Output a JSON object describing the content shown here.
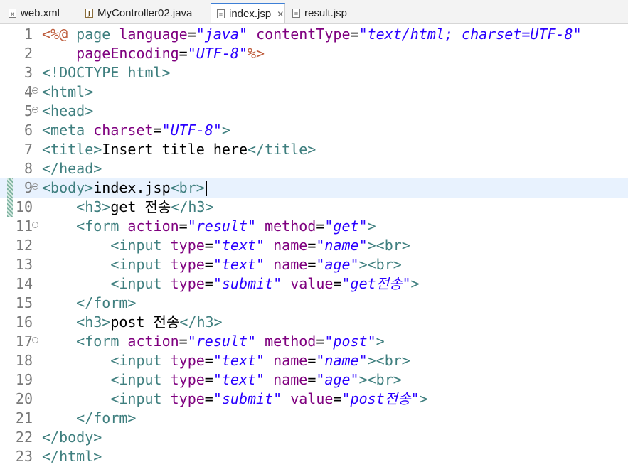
{
  "tabs": [
    {
      "label": "web.xml",
      "icon": "xml-file-icon"
    },
    {
      "label": "MyController02.java",
      "icon": "java-file-icon"
    },
    {
      "label": "index.jsp",
      "icon": "jsp-file-icon",
      "active": true,
      "close_icon": "close-icon"
    },
    {
      "label": "result.jsp",
      "icon": "jsp-file-icon"
    }
  ],
  "editor": {
    "colors": {
      "directive": "#bf5f3f",
      "tag": "#3f7f7f",
      "attribute": "#7f007f",
      "value": "#2a00ff",
      "text": "#000000",
      "current_line": "#e8f2fe"
    },
    "lines": [
      {
        "num": "1",
        "fold": false,
        "segs": [
          [
            "d",
            "<%@ "
          ],
          [
            "dn",
            "page "
          ],
          [
            "a",
            "language"
          ],
          [
            "o",
            "="
          ],
          [
            "v",
            "\"java\""
          ],
          [
            "o",
            " "
          ],
          [
            "a",
            "contentType"
          ],
          [
            "o",
            "="
          ],
          [
            "v",
            "\"text/html; charset=UTF-8\""
          ]
        ]
      },
      {
        "num": "2",
        "fold": false,
        "segs": [
          [
            "o",
            "    "
          ],
          [
            "a",
            "pageEncoding"
          ],
          [
            "o",
            "="
          ],
          [
            "v",
            "\"UTF-8\""
          ],
          [
            "d",
            "%>"
          ]
        ]
      },
      {
        "num": "3",
        "fold": false,
        "segs": [
          [
            "t",
            "<!DOCTYPE html>"
          ]
        ]
      },
      {
        "num": "4",
        "fold": true,
        "segs": [
          [
            "t",
            "<html>"
          ]
        ]
      },
      {
        "num": "5",
        "fold": true,
        "segs": [
          [
            "t",
            "<head>"
          ]
        ]
      },
      {
        "num": "6",
        "fold": false,
        "segs": [
          [
            "t",
            "<meta "
          ],
          [
            "a",
            "charset"
          ],
          [
            "o",
            "="
          ],
          [
            "v",
            "\"UTF-8\""
          ],
          [
            "t",
            ">"
          ]
        ]
      },
      {
        "num": "7",
        "fold": false,
        "segs": [
          [
            "t",
            "<title>"
          ],
          [
            "x",
            "Insert title here"
          ],
          [
            "t",
            "</title>"
          ]
        ]
      },
      {
        "num": "8",
        "fold": false,
        "segs": [
          [
            "t",
            "</head>"
          ]
        ]
      },
      {
        "num": "9",
        "fold": true,
        "current": true,
        "segs": [
          [
            "t",
            "<body>"
          ],
          [
            "x",
            "index.jsp"
          ],
          [
            "t",
            "<br>"
          ]
        ]
      },
      {
        "num": "10",
        "fold": false,
        "segs": [
          [
            "o",
            "    "
          ],
          [
            "t",
            "<h3>"
          ],
          [
            "x",
            "get 전송"
          ],
          [
            "t",
            "</h3>"
          ]
        ]
      },
      {
        "num": "11",
        "fold": true,
        "segs": [
          [
            "o",
            "    "
          ],
          [
            "t",
            "<form "
          ],
          [
            "a",
            "action"
          ],
          [
            "o",
            "="
          ],
          [
            "v",
            "\"result\""
          ],
          [
            "o",
            " "
          ],
          [
            "a",
            "method"
          ],
          [
            "o",
            "="
          ],
          [
            "v",
            "\"get\""
          ],
          [
            "t",
            ">"
          ]
        ]
      },
      {
        "num": "12",
        "fold": false,
        "segs": [
          [
            "o",
            "        "
          ],
          [
            "t",
            "<input "
          ],
          [
            "a",
            "type"
          ],
          [
            "o",
            "="
          ],
          [
            "v",
            "\"text\""
          ],
          [
            "o",
            " "
          ],
          [
            "a",
            "name"
          ],
          [
            "o",
            "="
          ],
          [
            "v",
            "\"name\""
          ],
          [
            "t",
            "><br>"
          ]
        ]
      },
      {
        "num": "13",
        "fold": false,
        "segs": [
          [
            "o",
            "        "
          ],
          [
            "t",
            "<input "
          ],
          [
            "a",
            "type"
          ],
          [
            "o",
            "="
          ],
          [
            "v",
            "\"text\""
          ],
          [
            "o",
            " "
          ],
          [
            "a",
            "name"
          ],
          [
            "o",
            "="
          ],
          [
            "v",
            "\"age\""
          ],
          [
            "t",
            "><br>"
          ]
        ]
      },
      {
        "num": "14",
        "fold": false,
        "segs": [
          [
            "o",
            "        "
          ],
          [
            "t",
            "<input "
          ],
          [
            "a",
            "type"
          ],
          [
            "o",
            "="
          ],
          [
            "v",
            "\"submit\""
          ],
          [
            "o",
            " "
          ],
          [
            "a",
            "value"
          ],
          [
            "o",
            "="
          ],
          [
            "v",
            "\"get전송\""
          ],
          [
            "t",
            ">"
          ]
        ]
      },
      {
        "num": "15",
        "fold": false,
        "segs": [
          [
            "o",
            "    "
          ],
          [
            "t",
            "</form>"
          ]
        ]
      },
      {
        "num": "16",
        "fold": false,
        "segs": [
          [
            "o",
            "    "
          ],
          [
            "t",
            "<h3>"
          ],
          [
            "x",
            "post 전송"
          ],
          [
            "t",
            "</h3>"
          ]
        ]
      },
      {
        "num": "17",
        "fold": true,
        "segs": [
          [
            "o",
            "    "
          ],
          [
            "t",
            "<form "
          ],
          [
            "a",
            "action"
          ],
          [
            "o",
            "="
          ],
          [
            "v",
            "\"result\""
          ],
          [
            "o",
            " "
          ],
          [
            "a",
            "method"
          ],
          [
            "o",
            "="
          ],
          [
            "v",
            "\"post\""
          ],
          [
            "t",
            ">"
          ]
        ]
      },
      {
        "num": "18",
        "fold": false,
        "segs": [
          [
            "o",
            "        "
          ],
          [
            "t",
            "<input "
          ],
          [
            "a",
            "type"
          ],
          [
            "o",
            "="
          ],
          [
            "v",
            "\"text\""
          ],
          [
            "o",
            " "
          ],
          [
            "a",
            "name"
          ],
          [
            "o",
            "="
          ],
          [
            "v",
            "\"name\""
          ],
          [
            "t",
            "><br>"
          ]
        ]
      },
      {
        "num": "19",
        "fold": false,
        "segs": [
          [
            "o",
            "        "
          ],
          [
            "t",
            "<input "
          ],
          [
            "a",
            "type"
          ],
          [
            "o",
            "="
          ],
          [
            "v",
            "\"text\""
          ],
          [
            "o",
            " "
          ],
          [
            "a",
            "name"
          ],
          [
            "o",
            "="
          ],
          [
            "v",
            "\"age\""
          ],
          [
            "t",
            "><br>"
          ]
        ]
      },
      {
        "num": "20",
        "fold": false,
        "segs": [
          [
            "o",
            "        "
          ],
          [
            "t",
            "<input "
          ],
          [
            "a",
            "type"
          ],
          [
            "o",
            "="
          ],
          [
            "v",
            "\"submit\""
          ],
          [
            "o",
            " "
          ],
          [
            "a",
            "value"
          ],
          [
            "o",
            "="
          ],
          [
            "v",
            "\"post전송\""
          ],
          [
            "t",
            ">"
          ]
        ]
      },
      {
        "num": "21",
        "fold": false,
        "segs": [
          [
            "o",
            "    "
          ],
          [
            "t",
            "</form>"
          ]
        ]
      },
      {
        "num": "22",
        "fold": false,
        "segs": [
          [
            "t",
            "</body>"
          ]
        ]
      },
      {
        "num": "23",
        "fold": false,
        "segs": [
          [
            "t",
            "</html>"
          ]
        ]
      }
    ]
  }
}
